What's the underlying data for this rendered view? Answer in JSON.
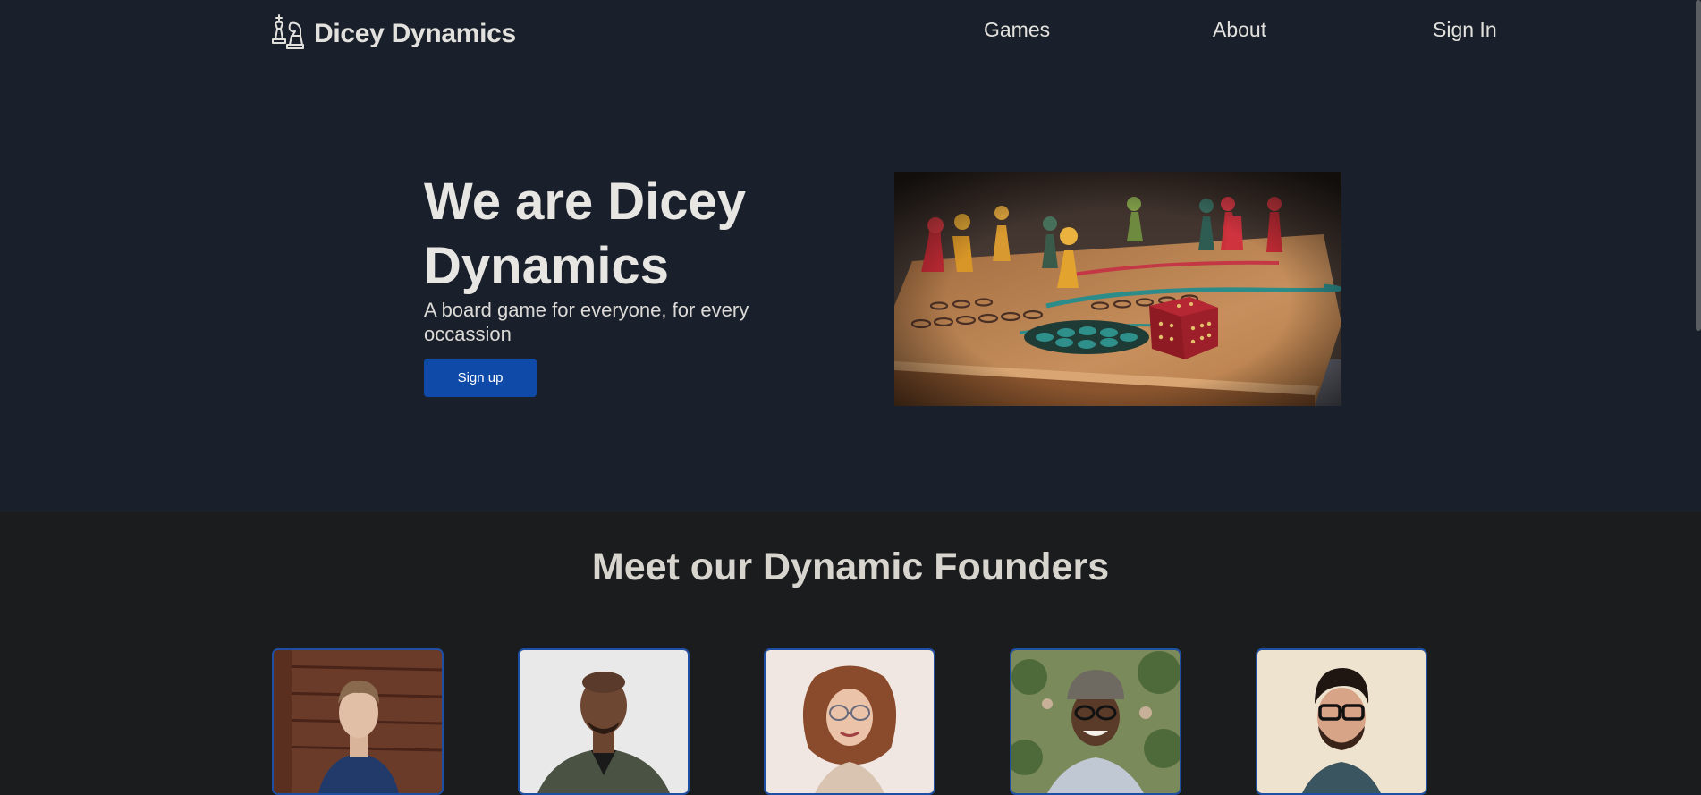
{
  "nav": {
    "brand": "Dicey Dynamics",
    "links": [
      {
        "label": "Games"
      },
      {
        "label": "About"
      },
      {
        "label": "Sign In"
      }
    ]
  },
  "hero": {
    "title": "We are Dicey Dynamics",
    "subtitle": "A board game for everyone, for every occassion",
    "signup_label": "Sign up",
    "image_icon": "board-game-photo"
  },
  "founders": {
    "title": "Meet our Dynamic Founders",
    "count_visible": 5
  },
  "colors": {
    "hero_bg": "#1a202b",
    "page_bg": "#1b1c1e",
    "accent": "#0f4aa8",
    "card_border": "#1f4fa3"
  },
  "icons": {
    "logo": "chess-pieces-icon"
  }
}
